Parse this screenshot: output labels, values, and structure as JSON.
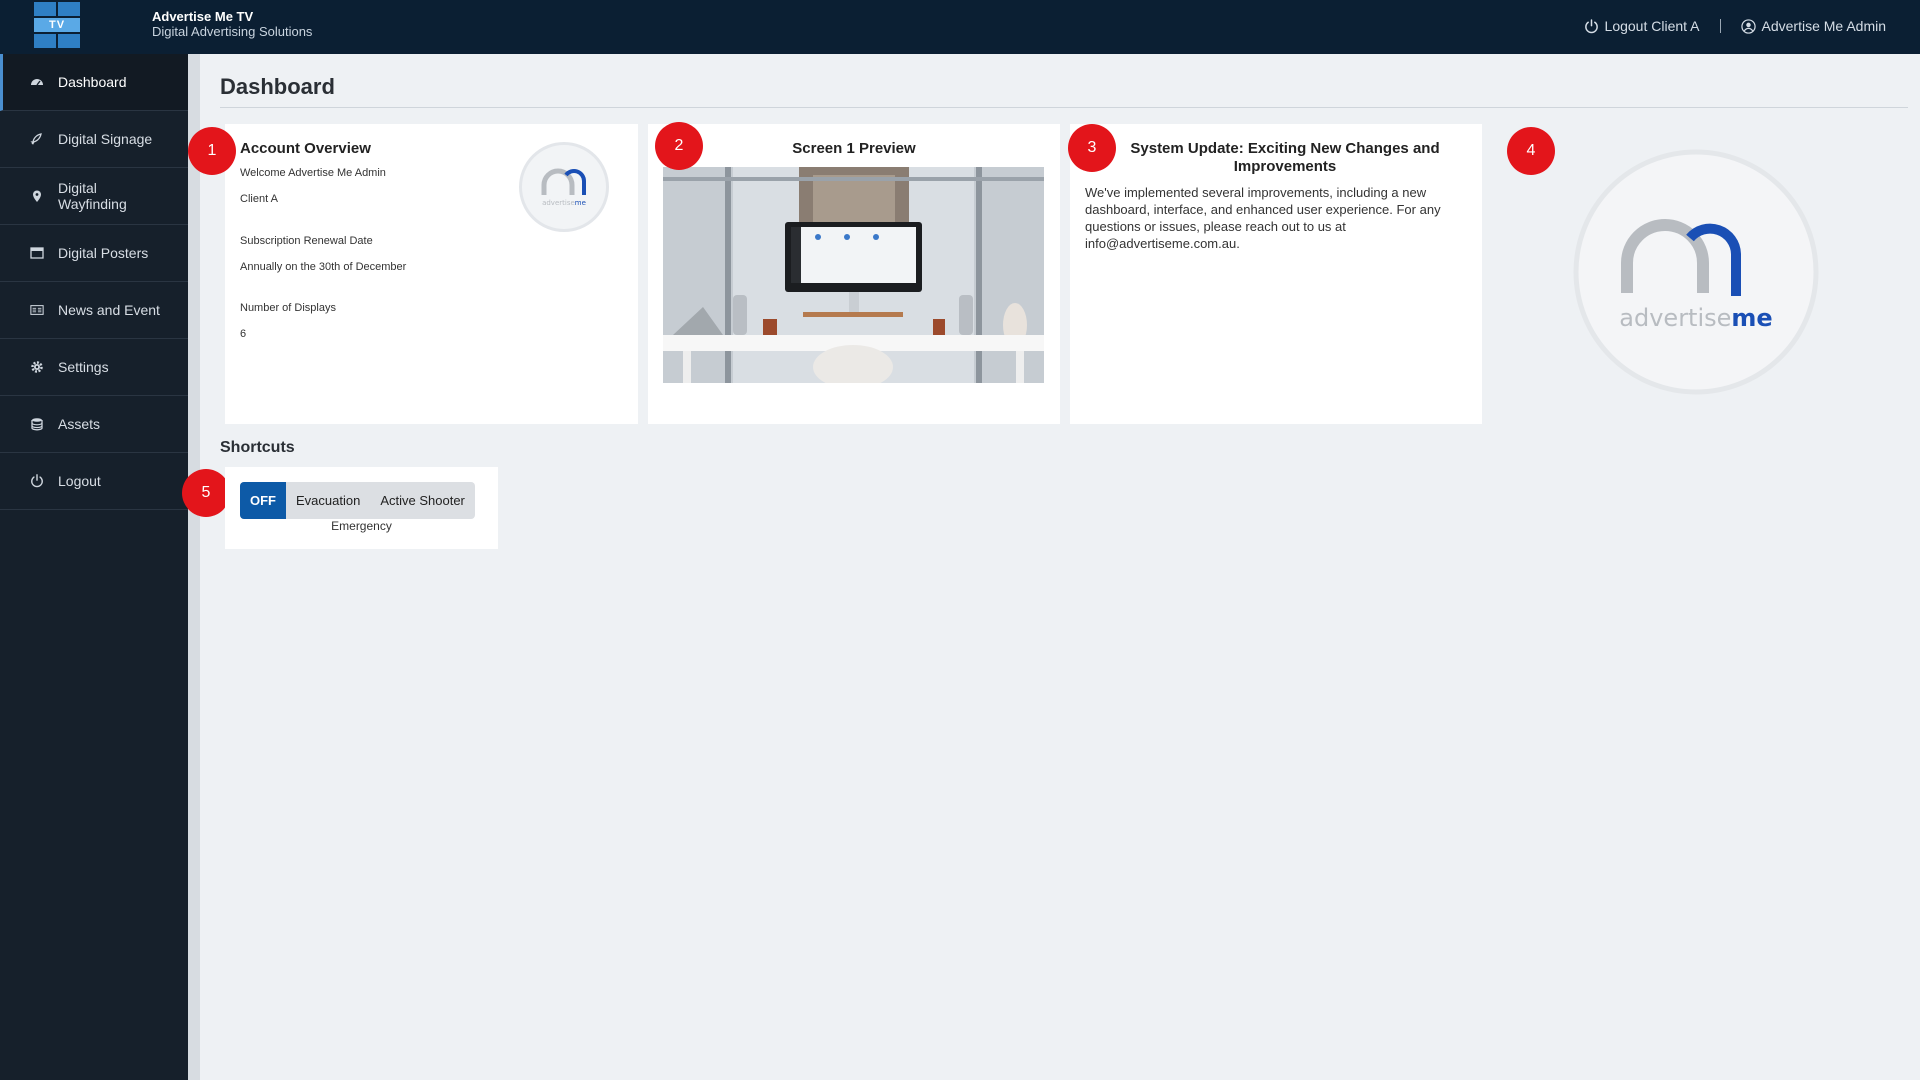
{
  "header": {
    "logo_text": "TV",
    "app_name": "Advertise Me TV",
    "tagline": "Digital Advertising Solutions",
    "logout_label": "Logout Client A",
    "user_label": "Advertise Me Admin"
  },
  "sidebar": {
    "items": [
      {
        "label": "Dashboard",
        "icon": "dashboard-icon",
        "active": true
      },
      {
        "label": "Digital Signage",
        "icon": "rocket-icon"
      },
      {
        "label": "Digital Wayfinding",
        "icon": "map-pin-icon"
      },
      {
        "label": "Digital Posters",
        "icon": "poster-icon"
      },
      {
        "label": "News and Event",
        "icon": "newspaper-icon"
      },
      {
        "label": "Settings",
        "icon": "gear-icon"
      },
      {
        "label": "Assets",
        "icon": "database-icon"
      },
      {
        "label": "Logout",
        "icon": "power-icon"
      }
    ]
  },
  "main": {
    "title": "Dashboard",
    "account": {
      "title": "Account Overview",
      "welcome": "Welcome Advertise Me Admin",
      "client": "Client A",
      "renewal_label": "Subscription Renewal Date",
      "renewal_value": "Annually on the 30th of December",
      "displays_label": "Number of Displays",
      "displays_value": "6"
    },
    "preview": {
      "title": "Screen 1 Preview"
    },
    "update": {
      "title": "System Update: Exciting New Changes and Improvements",
      "body": "We've implemented several improvements, including a new dashboard, interface, and enhanced user experience. For any questions or issues, please reach out to us at info@advertiseme.com.au."
    },
    "brand_logo": {
      "prefix": "advertise",
      "suffix": "me",
      "accent": "#1a4fb5",
      "gray": "#b8bcc1"
    },
    "shortcuts": {
      "title": "Shortcuts",
      "options": [
        "OFF",
        "Evacuation",
        "Active Shooter"
      ],
      "selected": "OFF",
      "caption": "Emergency"
    },
    "badges": [
      "1",
      "2",
      "3",
      "4",
      "5"
    ]
  },
  "colors": {
    "topbar": "#0b1f33",
    "sidebar": "#16202b",
    "badge": "#e3151b",
    "toggle_on": "#0d5aa7"
  }
}
